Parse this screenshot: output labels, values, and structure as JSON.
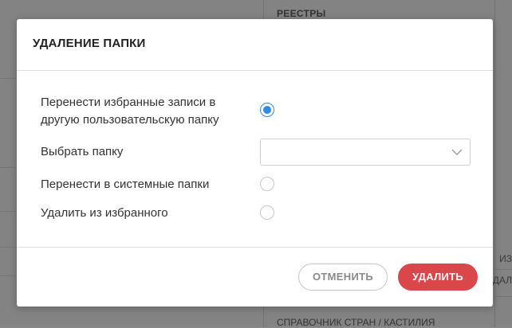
{
  "background": {
    "top_label": "РЕЕСТРЫ",
    "bottom_label": "СПРАВОЧНИК СТРАН / КАСТИЛИЯ",
    "side_label_1": "ИЗ",
    "side_label_2": "ДАЛ"
  },
  "dialog": {
    "title": "УДАЛЕНИЕ ПАПКИ",
    "options": [
      {
        "label": "Перенести избранные записи в другую пользовательскую папку",
        "selected": true
      },
      {
        "label": "Перенести в системные папки",
        "selected": false
      },
      {
        "label": "Удалить из избранного",
        "selected": false
      }
    ],
    "folder_select": {
      "label": "Выбрать папку",
      "value": "",
      "icon": "chevron-down-icon"
    },
    "buttons": {
      "cancel": "ОТМЕНИТЬ",
      "delete": "УДАЛИТЬ"
    }
  },
  "colors": {
    "accent": "#2f8be6",
    "danger": "#d9474b",
    "overlay": "#8c8c8c"
  }
}
